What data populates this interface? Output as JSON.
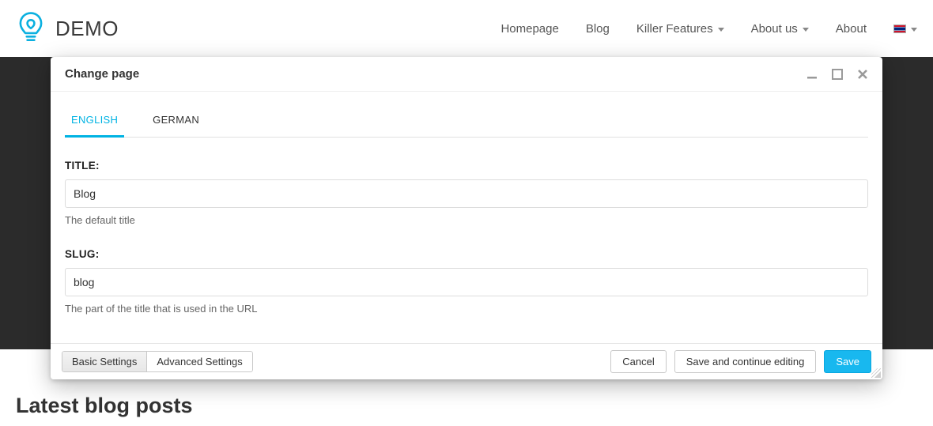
{
  "brand": "DEMO",
  "nav": {
    "items": [
      {
        "label": "Homepage",
        "has_dropdown": false
      },
      {
        "label": "Blog",
        "has_dropdown": false
      },
      {
        "label": "Killer Features",
        "has_dropdown": true
      },
      {
        "label": "About us",
        "has_dropdown": true
      },
      {
        "label": "About",
        "has_dropdown": false
      }
    ],
    "language": "en-gb"
  },
  "modal": {
    "title": "Change page",
    "lang_tabs": [
      {
        "label": "English",
        "active": true
      },
      {
        "label": "German",
        "active": false
      }
    ],
    "form": {
      "title": {
        "label": "TITLE:",
        "value": "Blog",
        "help": "The default title"
      },
      "slug": {
        "label": "SLUG:",
        "value": "blog",
        "help": "The part of the title that is used in the URL"
      }
    },
    "footer": {
      "settings_tabs": [
        {
          "label": "Basic Settings",
          "active": true
        },
        {
          "label": "Advanced Settings",
          "active": false
        }
      ],
      "cancel": "Cancel",
      "save_continue": "Save and continue editing",
      "save": "Save"
    }
  },
  "page": {
    "section_heading": "Latest blog posts"
  }
}
